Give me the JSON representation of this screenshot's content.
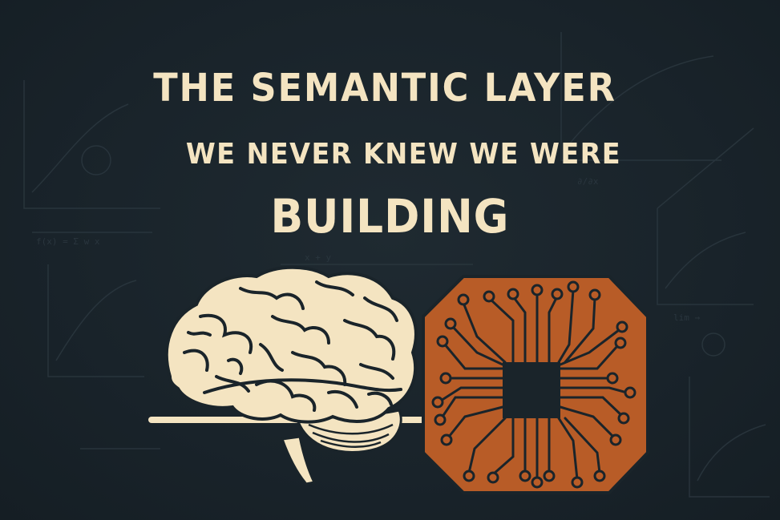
{
  "headline": {
    "line1": "THE SEMANTIC LAYER",
    "line2": "WE NEVER KNEW WE WERE",
    "line3": "BUILDING"
  },
  "colors": {
    "background": "#1a242a",
    "text": "#f4e4c1",
    "brain_fill": "#f4e4c1",
    "brain_stroke": "#1a242a",
    "chip_fill": "#b85c27",
    "chip_trace": "#1a242a"
  },
  "icons": {
    "brain": "brain-icon",
    "chip": "circuit-chip-icon"
  }
}
